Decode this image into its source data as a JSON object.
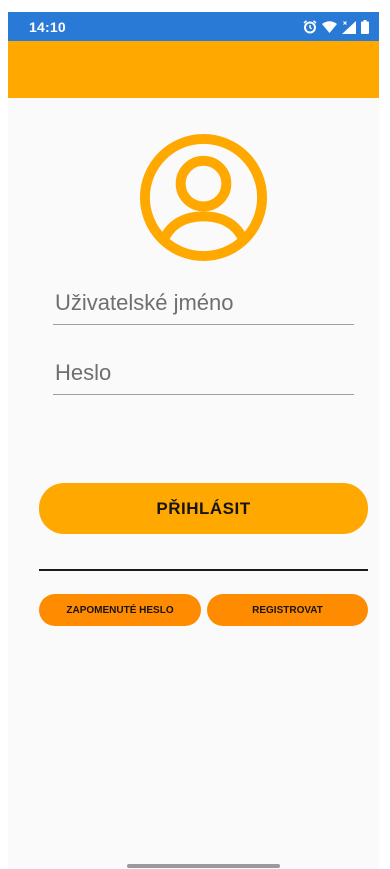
{
  "status_bar": {
    "time": "14:10",
    "icons": [
      "alarm-icon",
      "wifi-icon",
      "cellular-signal-icon",
      "battery-icon"
    ]
  },
  "login_form": {
    "avatar_icon": "account-circle-icon",
    "username": {
      "placeholder": "Uživatelské jméno",
      "value": ""
    },
    "password": {
      "placeholder": "Heslo",
      "value": ""
    },
    "login_label": "PŘIHLÁSIT",
    "forgot_password_label": "ZAPOMENUTÉ HESLO",
    "register_label": "REGISTROVAT"
  },
  "colors": {
    "status_bar": "#2979d6",
    "app_bar": "#ffa800",
    "primary_button": "#ffa800",
    "secondary_button": "#ff8c00"
  }
}
